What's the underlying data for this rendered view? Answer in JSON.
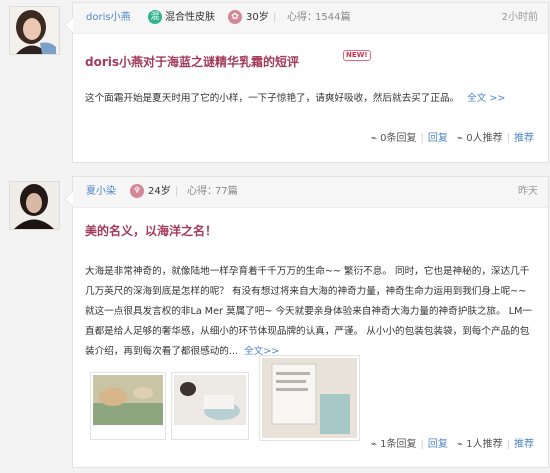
{
  "posts": [
    {
      "username": "doris小燕",
      "skin_icon": "混",
      "skin_type": "混合性皮肤",
      "age_icon": "✿",
      "age": "30岁",
      "reviews_label": "心得：",
      "reviews_count": "1544篇",
      "time": "2小时前",
      "title": "doris小燕对于海蓝之谜精华乳霜的短评",
      "badge": "NEW!",
      "body": "这个面霜开始是夏天时用了它的小样，一下子惊艳了，请爽好吸收，然后就去买了正品。",
      "more": "全文 >>",
      "actions": {
        "comments": "0条回复",
        "reply": "回复",
        "recommend_count": "0人推荐",
        "recommend": "推荐"
      }
    },
    {
      "username": "夏小染",
      "age_icon": "♆",
      "age": "24岁",
      "reviews_label": "心得：",
      "reviews_count": "77篇",
      "time": "昨天",
      "title": "美的名义，以海洋之名！",
      "body": "大海是非常神奇的，就像陆地一样孕育着千千万万的生命~~ 繁衍不息。 同时，它也是神秘的，深达几千几万英尺的深海到底是怎样的呢？ 有没有想过将来自大海的神奇力量，神奇生命力运用到我们身上呢~~ 就这一点很具发言权的非La Mer 莫属了吧~ 今天就要亲身体验来自神奇大海力量的神奇护肤之旅。 LM一直都是给人足够的奢华感，从细小的环节体现品牌的认真，严谨。 从小小的包装包装袋，到每个产品的包装介绍，再到每次看了都很感动的...",
      "more": "全文>>",
      "actions": {
        "comments": "1条回复",
        "reply": "回复",
        "recommend_count": "1人推荐",
        "recommend": "推荐"
      }
    }
  ]
}
